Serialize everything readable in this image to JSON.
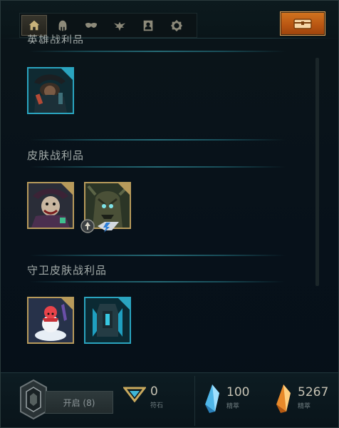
{
  "nav": {
    "items": [
      {
        "icon": "home-icon",
        "active": true
      },
      {
        "icon": "champion-helmet-icon",
        "active": false
      },
      {
        "icon": "skin-mask-icon",
        "active": false
      },
      {
        "icon": "ward-wings-icon",
        "active": false
      },
      {
        "icon": "summoner-icon-portrait",
        "active": false
      },
      {
        "icon": "emote-icon",
        "active": false
      }
    ],
    "chest_button_icon": "hextech-chest-icon"
  },
  "sections": [
    {
      "title": "英雄战利品",
      "items": [
        {
          "border": "blue",
          "art": "champion-shard-twisted-fate"
        }
      ]
    },
    {
      "title": "皮肤战利品",
      "items": [
        {
          "border": "gold",
          "art": "skin-shard-jester"
        },
        {
          "border": "gold",
          "art": "skin-shard-tree-monster",
          "badges": [
            "upgrade-icon",
            "essence-icon"
          ]
        }
      ]
    },
    {
      "title": "守卫皮肤战利品",
      "items": [
        {
          "border": "gold",
          "art": "ward-skin-snowman"
        },
        {
          "border": "blue",
          "art": "ward-skin-hextech"
        }
      ]
    }
  ],
  "footer": {
    "open_button_label": "开启 (8)",
    "runes": {
      "value": "0",
      "label": "符石"
    },
    "blue_essence": {
      "value": "100",
      "label": "精萃"
    },
    "orange_essence": {
      "value": "5267",
      "label": "精萃"
    }
  },
  "colors": {
    "gold_border": "#b79a5b",
    "blue_border": "#2aa4bf",
    "accent_orange": "#c8661a"
  }
}
